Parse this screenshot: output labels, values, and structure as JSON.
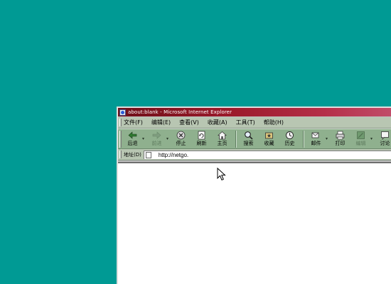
{
  "window": {
    "title": "about:blank - Microsoft Internet Explorer"
  },
  "menu": {
    "items": [
      {
        "label": "文件(F)"
      },
      {
        "label": "编辑(E)"
      },
      {
        "label": "查看(V)"
      },
      {
        "label": "收藏(A)"
      },
      {
        "label": "工具(T)"
      },
      {
        "label": "帮助(H)"
      }
    ]
  },
  "toolbar": {
    "buttons": [
      {
        "label": "后退",
        "icon": "back-arrow-icon"
      },
      {
        "label": "前进",
        "icon": "forward-arrow-icon"
      },
      {
        "label": "停止",
        "icon": "stop-icon"
      },
      {
        "label": "刷新",
        "icon": "refresh-icon"
      },
      {
        "label": "主页",
        "icon": "home-icon"
      },
      {
        "label": "搜索",
        "icon": "search-icon"
      },
      {
        "label": "收藏",
        "icon": "favorites-icon"
      },
      {
        "label": "历史",
        "icon": "history-icon"
      },
      {
        "label": "邮件",
        "icon": "mail-icon"
      },
      {
        "label": "打印",
        "icon": "print-icon"
      },
      {
        "label": "编辑",
        "icon": "edit-icon"
      },
      {
        "label": "讨论",
        "icon": "discuss-icon"
      }
    ]
  },
  "address": {
    "label": "地址(D)",
    "url": "http://netgo."
  },
  "colors": {
    "desktop": "#009a94",
    "toolbar": "#8fb08e",
    "title_start": "#6e0f18",
    "title_end": "#c14d6a"
  }
}
